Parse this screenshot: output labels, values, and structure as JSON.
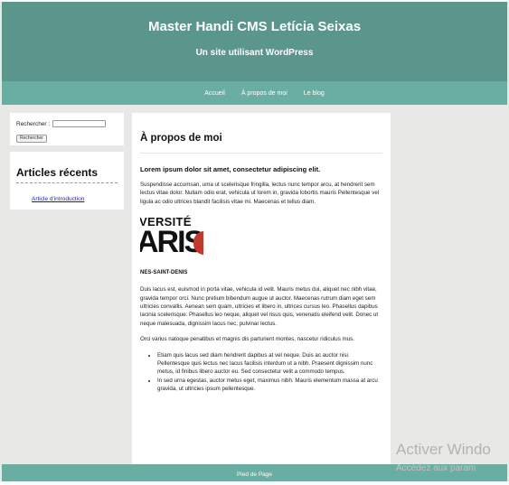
{
  "site": {
    "title": "Master Handi CMS Letícia Seixas",
    "tagline": "Un site utilisant WordPress"
  },
  "nav": {
    "items": [
      "Accueil",
      "À propos de moi",
      "Le blog"
    ]
  },
  "search": {
    "label": "Rechercher :",
    "input_value": "",
    "button_label": "Rechercher"
  },
  "recent": {
    "title": "Articles récents",
    "items": [
      "Article d'introduction"
    ]
  },
  "main": {
    "page_title": "À propos de moi",
    "lead": "Lorem ipsum dolor sit amet, consectetur adipiscing elit.",
    "para1": "Suspendisse accumsan, uma ut scelerisque fringilla, lectus nunc tempor arcu, at hendrerit sem lectus vitae dolor. Nullam odio erat, vehicula ut lorem in, gravida lobortis mauris Pellentesque vel ligula ac odio ultrices blandit facilisis vitae mi. Maecenas et tellus diam.",
    "logo": {
      "line1": "VERSITÉ",
      "line2": "ARIS",
      "line3": "NES-SAINT-DENIS"
    },
    "para2": "Duis lacus est, euismod in porta vitae, vehicula id velit. Mauris metus dui, aliquet nec nibh vitae, gravida tempor orci. Nunc pretium bibendum augue ut auctor. Maecenas rutrum diam eget sem ultricies convallis. Aenean sem quam, ultricies et libero in, ultrices cursus leo. Phasellus dapibus lacinia scelerisque. Phasellus leo neque, aliquet vel risus quis, venenatis eleifend velit. Donec ut neque malesuada, dignissim lacus nec, pulvinar lectus.",
    "para3": "Orci varius natoque penatibus et magnis dis parturient montes, nascetur ridiculus mus.",
    "bullets": [
      "Etiam quis lacus sed diam hendrerit dapibus at vel neque. Duis ac auctor nisi. Pellentesque quis lectus nec lacus facilisis interdum ut a nibh. Praesent dignissim nunc metus, id finibus libero auctor eu. Sed consectetur velit a commodo tempus.",
      "In sed urna egestas, auctor metus eget, maximus nibh. Mauris elementum massa at arcu gravida, ut ultricies ipsum pellentesque."
    ]
  },
  "footer": {
    "text": "Pied de Page"
  },
  "watermark": {
    "title": "Activer Windo",
    "subtitle": "Accédez aux param"
  },
  "colors": {
    "header_bg": "#5a968c",
    "nav_bg": "#6aada3",
    "link": "#1a1ab0"
  }
}
